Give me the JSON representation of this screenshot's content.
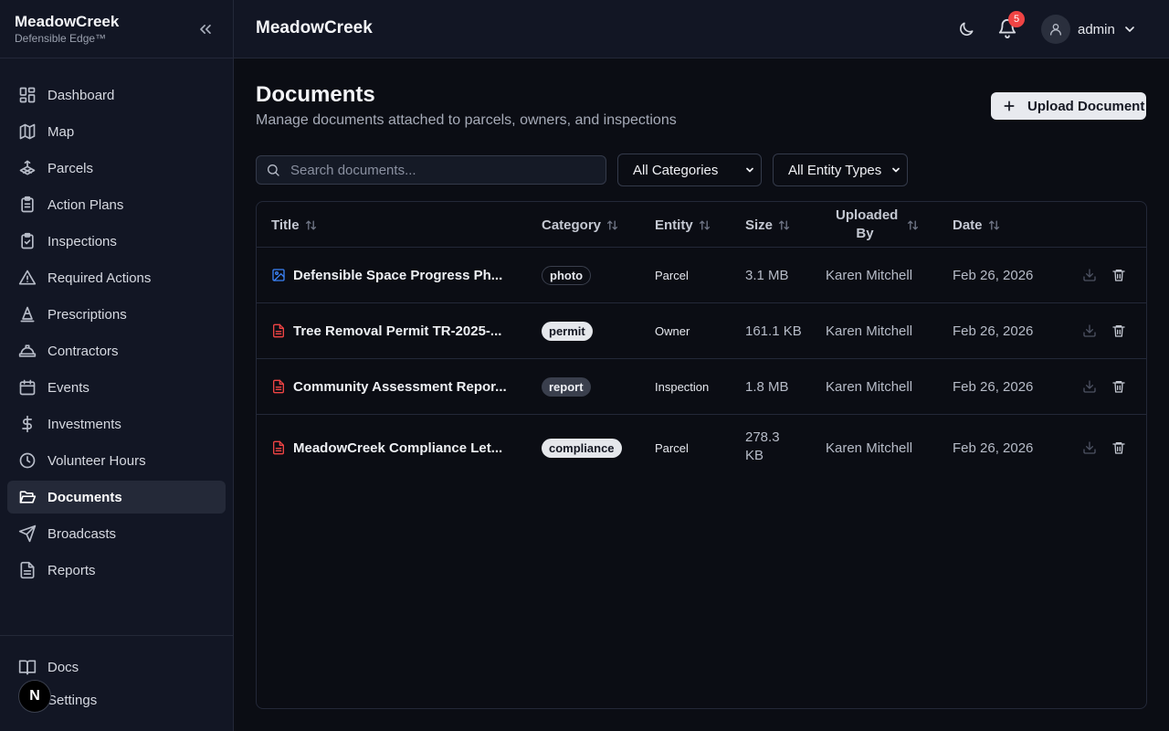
{
  "sidebar": {
    "brand": "MeadowCreek",
    "tagline": "Defensible Edge™",
    "items": [
      {
        "label": "Dashboard",
        "icon": "dashboard-icon"
      },
      {
        "label": "Map",
        "icon": "map-icon"
      },
      {
        "label": "Parcels",
        "icon": "parcels-icon"
      },
      {
        "label": "Action Plans",
        "icon": "clipboard-icon"
      },
      {
        "label": "Inspections",
        "icon": "clipboard-check-icon"
      },
      {
        "label": "Required Actions",
        "icon": "warning-icon"
      },
      {
        "label": "Prescriptions",
        "icon": "cone-icon"
      },
      {
        "label": "Contractors",
        "icon": "hard-hat-icon"
      },
      {
        "label": "Events",
        "icon": "calendar-icon"
      },
      {
        "label": "Investments",
        "icon": "dollar-icon"
      },
      {
        "label": "Volunteer Hours",
        "icon": "clock-icon"
      },
      {
        "label": "Documents",
        "icon": "folder-open-icon",
        "active": true
      },
      {
        "label": "Broadcasts",
        "icon": "send-icon"
      },
      {
        "label": "Reports",
        "icon": "file-text-icon"
      }
    ],
    "bottom": [
      {
        "label": "Docs",
        "icon": "book-icon"
      },
      {
        "label": "Settings",
        "icon": "gear-icon"
      }
    ],
    "dev_badge": "N"
  },
  "header": {
    "title": "MeadowCreek",
    "notification_count": "5",
    "user": "admin"
  },
  "page": {
    "title": "Documents",
    "subtitle": "Manage documents attached to parcels, owners, and inspections",
    "upload_label": "Upload Document"
  },
  "filters": {
    "search_placeholder": "Search documents...",
    "category": "All Categories",
    "entity_type": "All Entity Types"
  },
  "table": {
    "columns": {
      "title": "Title",
      "category": "Category",
      "entity": "Entity",
      "size": "Size",
      "uploaded_by_1": "Uploaded",
      "uploaded_by_2": "By",
      "date": "Date"
    },
    "rows": [
      {
        "title": "Defensible Space Progress Ph...",
        "file_icon": "image-file-icon",
        "category": "photo",
        "category_style": "outline",
        "entity": "Parcel",
        "size": "3.1 MB",
        "uploaded_by": "Karen Mitchell",
        "date": "Feb 26, 2026"
      },
      {
        "title": "Tree Removal Permit TR-2025-...",
        "file_icon": "document-file-icon",
        "category": "permit",
        "category_style": "solid",
        "entity": "Owner",
        "size": "161.1 KB",
        "uploaded_by": "Karen Mitchell",
        "date": "Feb 26, 2026"
      },
      {
        "title": "Community Assessment Repor...",
        "file_icon": "document-file-icon",
        "category": "report",
        "category_style": "solid-dark",
        "entity": "Inspection",
        "size": "1.8 MB",
        "uploaded_by": "Karen Mitchell",
        "date": "Feb 26, 2026"
      },
      {
        "title": "MeadowCreek Compliance Let...",
        "file_icon": "document-file-icon",
        "category": "compliance",
        "category_style": "solid",
        "entity": "Parcel",
        "size_line1": "278.3",
        "size_line2": "KB",
        "uploaded_by": "Karen Mitchell",
        "date": "Feb 26, 2026"
      }
    ]
  },
  "colors": {
    "background": "#0b0d14",
    "sidebar": "#121624",
    "border": "#232838",
    "active_nav": "#242938",
    "image_icon": "#3b82f6",
    "document_icon": "#ef4444",
    "notification": "#ef4444"
  }
}
